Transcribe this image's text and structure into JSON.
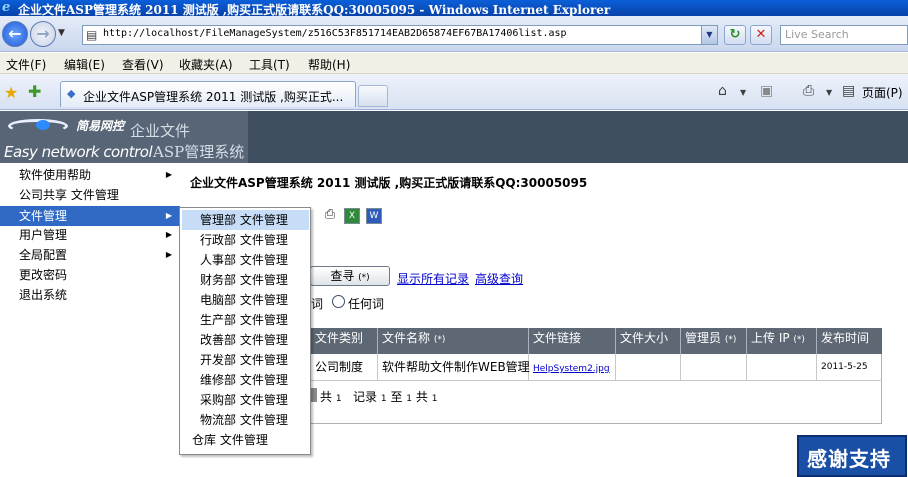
{
  "window": {
    "title": "企业文件ASP管理系统 2011 测试版 ,购买正式版请联系QQ:30005095 - Windows Internet Explorer"
  },
  "browser": {
    "address": "http://localhost/FileManageSystem/z516C53F851714EAB2D65874EF67BA17406list.asp",
    "search_placeholder": "Live Search",
    "menu": [
      "文件(F)",
      "编辑(E)",
      "查看(V)",
      "收藏夹(A)",
      "工具(T)",
      "帮助(H)"
    ],
    "tab_title": "企业文件ASP管理系统 2011 测试版 ,购买正式...",
    "page_label": "页面(P)"
  },
  "header": {
    "logo_cn": "简易网控",
    "logo_en": "Easy network control",
    "title_line1": "企业文件",
    "title_line2": "ASP管理系统"
  },
  "sidebar": {
    "items": [
      {
        "label": "软件使用帮助",
        "arrow": "▶"
      },
      {
        "label": "公司共享 文件管理",
        "arrow": ""
      },
      {
        "label": "文件管理",
        "arrow": "▶"
      },
      {
        "label": "用户管理",
        "arrow": "▶"
      },
      {
        "label": "全局配置",
        "arrow": "▶"
      },
      {
        "label": "更改密码",
        "arrow": ""
      },
      {
        "label": "退出系统",
        "arrow": ""
      }
    ]
  },
  "flyout": {
    "items": [
      "管理部 文件管理",
      "行政部 文件管理",
      "人事部 文件管理",
      "财务部 文件管理",
      "电脑部 文件管理",
      "生产部 文件管理",
      "改善部 文件管理",
      "开发部 文件管理",
      "维修部 文件管理",
      "采购部 文件管理",
      "物流部 文件管理",
      "仓库 文件管理"
    ]
  },
  "main": {
    "title": "企业文件ASP管理系统 2011 测试版 ,购买正式版请联系QQ:30005095",
    "search_button": "查寻",
    "search_button_mark": "(*)",
    "show_all": "显示所有记录",
    "advanced_search": "高级查询",
    "radio_partial_label": "词",
    "radio_any_label": "任何词"
  },
  "table": {
    "headers": [
      {
        "label": "文件类别",
        "mark": ""
      },
      {
        "label": "文件名称",
        "mark": "(*)"
      },
      {
        "label": "文件链接",
        "mark": ""
      },
      {
        "label": "文件大小",
        "mark": ""
      },
      {
        "label": "管理员",
        "mark": "(*)"
      },
      {
        "label": "上传 IP",
        "mark": "(*)"
      },
      {
        "label": "发布时间",
        "mark": ""
      }
    ],
    "row": {
      "category": "公司制度",
      "name": "软件帮助文件制作WEB管理",
      "link": "HelpSystem2.jpg",
      "size": "",
      "admin": "",
      "ip": "",
      "date": "2011-5-25"
    },
    "pager": {
      "total_pages_prefix": "共",
      "total_pages": "1",
      "records_label": "记录",
      "records_from": "1",
      "to_label": "至",
      "records_to": "1",
      "total_prefix": "共",
      "total": "1"
    }
  },
  "badge": {
    "label": "感谢支持"
  }
}
